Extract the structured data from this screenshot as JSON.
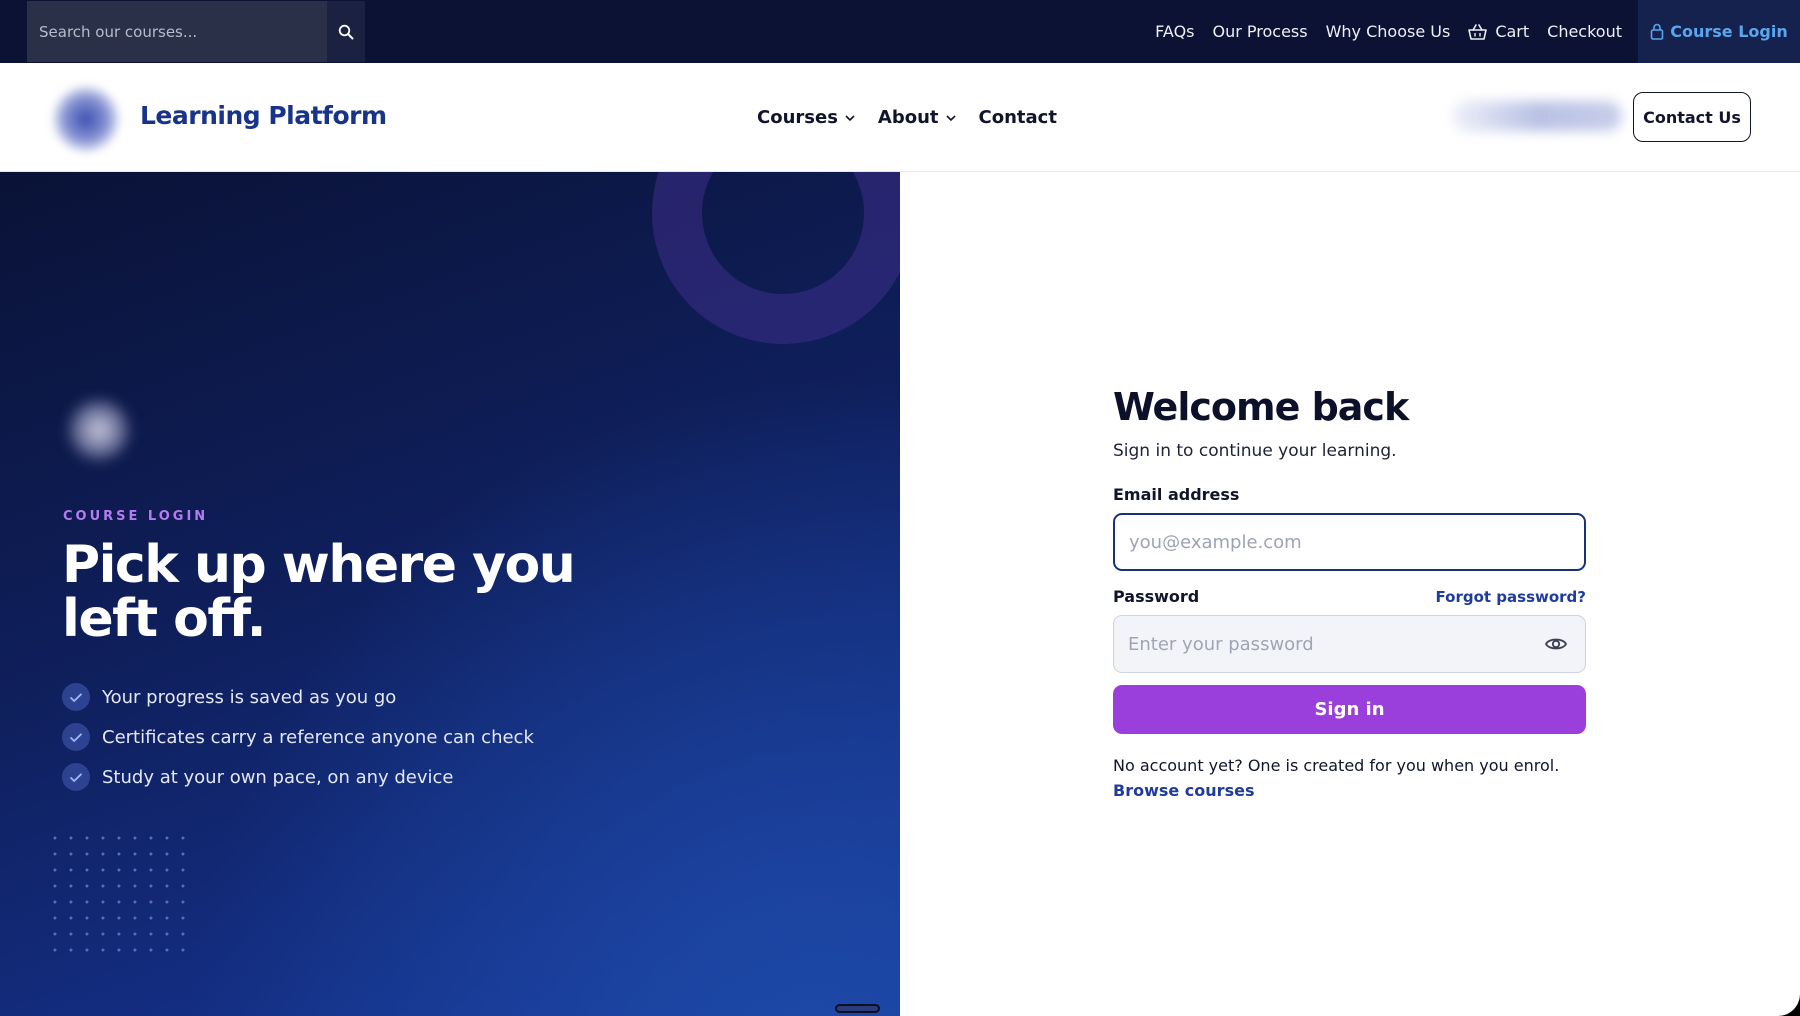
{
  "topbar": {
    "search_placeholder": "Search our courses...",
    "links": [
      {
        "label": "FAQs"
      },
      {
        "label": "Our Process"
      },
      {
        "label": "Why Choose Us"
      },
      {
        "label": "Cart",
        "icon": "basket-icon"
      },
      {
        "label": "Checkout"
      }
    ],
    "course_login": "Course Login"
  },
  "header": {
    "brand": "Learning Platform",
    "nav": [
      {
        "label": "Courses",
        "dropdown": true
      },
      {
        "label": "About",
        "dropdown": true
      },
      {
        "label": "Contact",
        "dropdown": false
      }
    ],
    "contact_button": "Contact Us"
  },
  "hero": {
    "eyebrow": "COURSE LOGIN",
    "title": "Pick up where you left off.",
    "bullets": [
      "Your progress is saved as you go",
      "Certificates carry a reference anyone can check",
      "Study at your own pace, on any device"
    ]
  },
  "form": {
    "title": "Welcome back",
    "subtitle": "Sign in to continue your learning.",
    "email_label": "Email address",
    "email_placeholder": "you@example.com",
    "password_label": "Password",
    "forgot_link": "Forgot password?",
    "password_placeholder": "Enter your password",
    "submit": "Sign in",
    "no_account": "No account yet? One is created for you when you enrol.",
    "browse_link": "Browse courses"
  },
  "colors": {
    "topbar_bg": "#0b1233",
    "brand_blue": "#17348a",
    "accent_purple": "#9a3fdb",
    "eyebrow_purple": "#b47cf0",
    "link_blue": "#1f3c9a",
    "login_blue": "#5aa6ee"
  }
}
